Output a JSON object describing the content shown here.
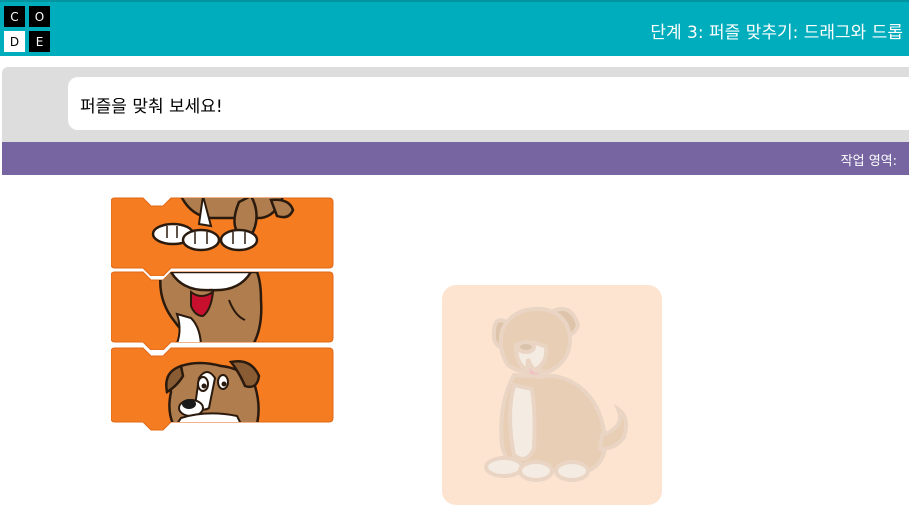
{
  "header": {
    "logo_letters": [
      "C",
      "O",
      "D",
      "E"
    ],
    "title": "단계 3: 퍼즐 맞추기: 드래그와 드롭"
  },
  "instructions": {
    "text": "퍼즐을 맞춰 보세요!"
  },
  "workspace": {
    "label": "작업 영역:"
  },
  "colors": {
    "header": "#00adbc",
    "workspace_header": "#7665a0",
    "block": "#f57c20",
    "target_bg": "#fde4d1",
    "dog_fur": "#b07d4e"
  },
  "blocks": [
    {
      "name": "puzzle-block-1",
      "part": "dog-paws"
    },
    {
      "name": "puzzle-block-2",
      "part": "dog-mouth"
    },
    {
      "name": "puzzle-block-3",
      "part": "dog-head"
    }
  ]
}
